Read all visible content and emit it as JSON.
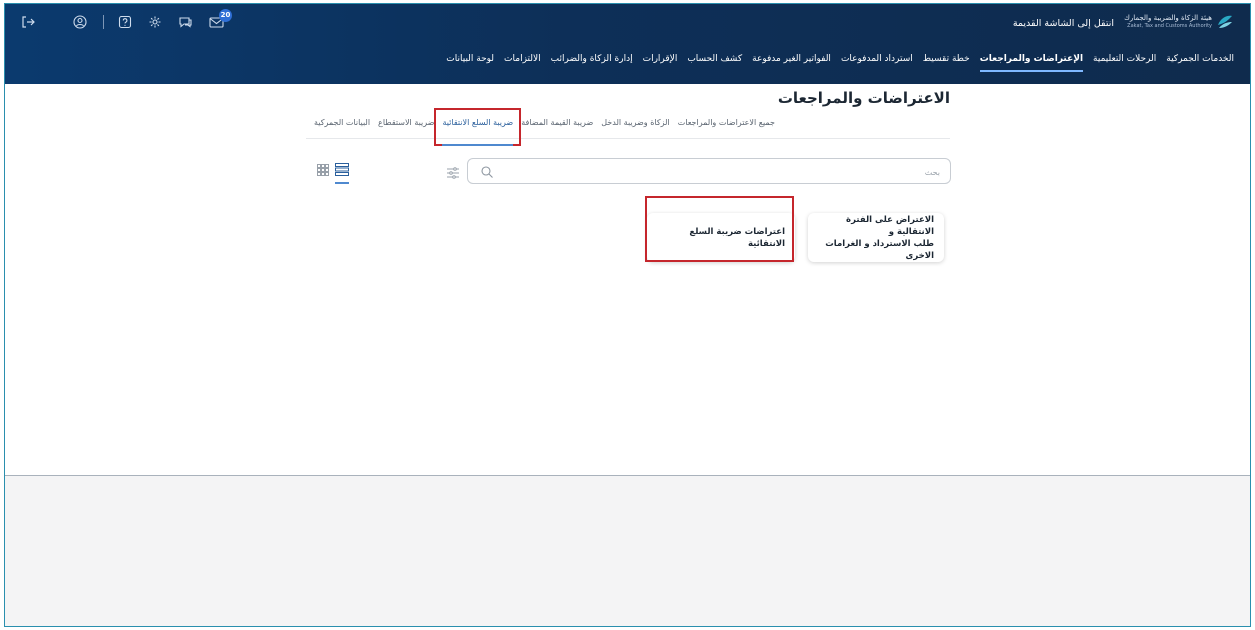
{
  "header": {
    "logo": {
      "name_ar": "هيئة الزكاة والضريبة والجمارك",
      "name_en": "Zakat, Tax and Customs Authority",
      "brand_color": "#2aa8c4"
    },
    "old_screen_link": "انتقل إلى الشاشة القديمة",
    "notification_badge": "20",
    "icons": [
      "logout-icon",
      "user-icon",
      "help-icon",
      "settings-icon",
      "chat-icon",
      "mail-icon"
    ]
  },
  "nav": {
    "items": [
      {
        "label": "لوحة البيانات",
        "active": false
      },
      {
        "label": "الالتزامات",
        "active": false
      },
      {
        "label": "إدارة الزكاة والضرائب",
        "active": false
      },
      {
        "label": "الإقرارات",
        "active": false
      },
      {
        "label": "كشف الحساب",
        "active": false
      },
      {
        "label": "الفواتير الغير مدفوعة",
        "active": false
      },
      {
        "label": "استرداد المدفوعات",
        "active": false
      },
      {
        "label": "خطة تقسيط",
        "active": false
      },
      {
        "label": "الإعتراضات والمراجعات",
        "active": true
      },
      {
        "label": "الرحلات التعليمية",
        "active": false
      },
      {
        "label": "الخدمات الجمركية",
        "active": false
      }
    ]
  },
  "page": {
    "title": "الاعتراضات والمراجعات",
    "tabs": [
      {
        "label": "جميع الاعتراضات والمراجعات",
        "active": false
      },
      {
        "label": "الزكاة وضريبة الدخل",
        "active": false
      },
      {
        "label": "ضريبة القيمة المضافة",
        "active": false
      },
      {
        "label": "ضريبة السلع الانتقائية",
        "active": true
      },
      {
        "label": "ضريبة الاستقطاع",
        "active": false
      },
      {
        "label": "البيانات الجمركية",
        "active": false
      }
    ],
    "search": {
      "placeholder": "بحث",
      "value": ""
    },
    "view_mode": "list",
    "cards": [
      {
        "title_line1": "الاعتراض على الفترة الانتقالية و",
        "title_line2": "طلب الاسترداد و الغرامات الاخرى"
      },
      {
        "title_line1": "اعتراضات ضريبة السلع الانتقائية",
        "title_line2": ""
      }
    ]
  },
  "colors": {
    "header_bg": "#0d2f58",
    "accent": "#4f89cf",
    "highlight": "#c5262c"
  }
}
